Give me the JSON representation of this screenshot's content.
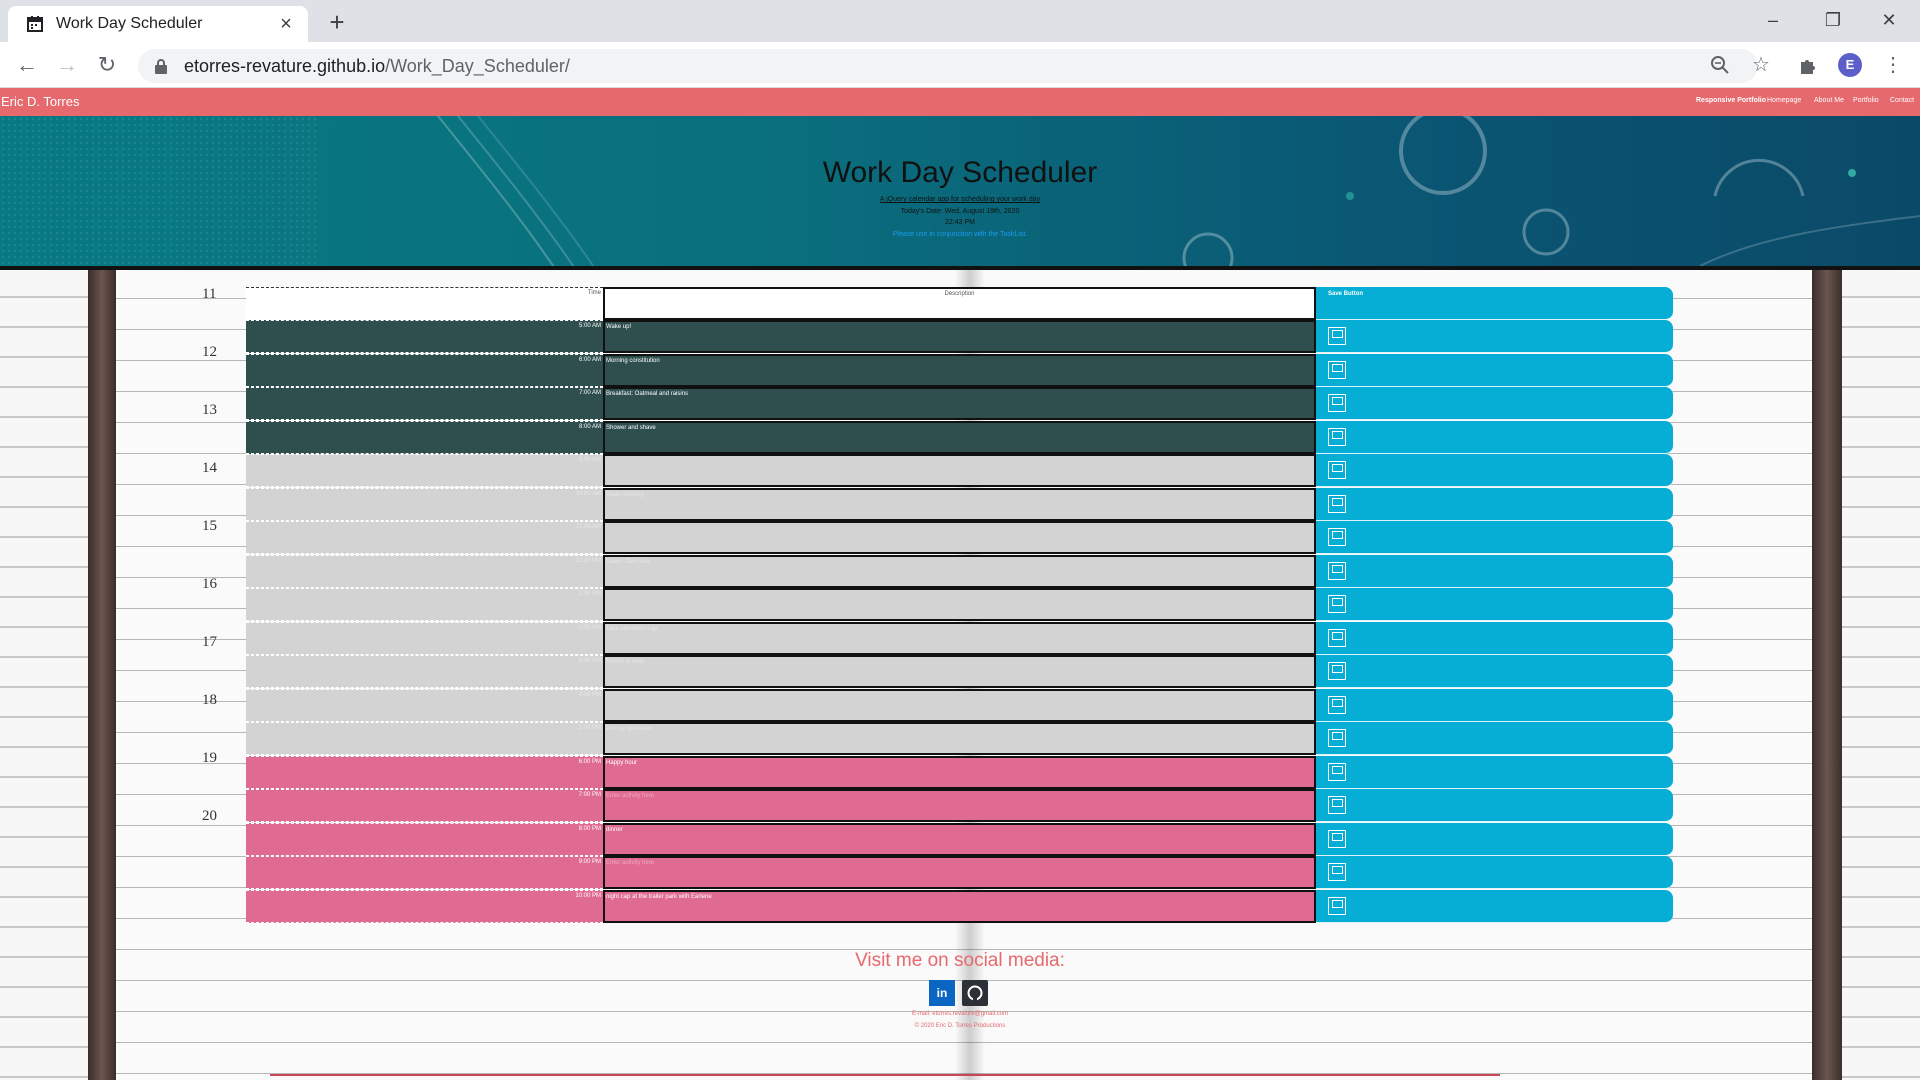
{
  "browser": {
    "tab_title": "Work Day Scheduler",
    "url_host": "etorres-revature.github.io",
    "url_path": "/Work_Day_Scheduler/",
    "profile_initial": "E"
  },
  "nav": {
    "brand": "Eric D. Torres",
    "links": [
      "Responsive Portfolio",
      "Homepage",
      "About Me",
      "Portfolio",
      "Contact"
    ]
  },
  "hero": {
    "title": "Work Day Scheduler",
    "subtitle": "A jQuery calendar app for scheduling your work day",
    "date_line": "Today's Date: Wed, August 19th, 2020",
    "time_line": "22:43 PM",
    "note": "Please use in conjunction with the TaskList."
  },
  "schedule": {
    "headers": {
      "time": "Time",
      "description": "Description",
      "save": "Save Button"
    },
    "rows": [
      {
        "time": "5:00 AM",
        "text": "Wake up!",
        "state": "past"
      },
      {
        "time": "6:00 AM",
        "text": "Morning constitution",
        "state": "past"
      },
      {
        "time": "7:00 AM",
        "text": "Breakfast: Oatmeal and raisins",
        "state": "past"
      },
      {
        "time": "8:00 AM",
        "text": "Shower and shave",
        "state": "past"
      },
      {
        "time": "9:00 AM",
        "text": "",
        "state": "present"
      },
      {
        "time": "10:00 AM",
        "text": "Team meeting",
        "state": "present"
      },
      {
        "time": "11:00 AM",
        "text": "",
        "state": "present"
      },
      {
        "time": "12:00 PM",
        "text": "Lunch: Dim sum",
        "state": "present"
      },
      {
        "time": "1:00 PM",
        "text": "",
        "state": "present"
      },
      {
        "time": "2:00 PM",
        "text": "Take afternoon nap",
        "state": "present"
      },
      {
        "time": "3:00 PM",
        "text": "Return to work",
        "state": "present"
      },
      {
        "time": "4:00 PM",
        "text": "",
        "state": "present"
      },
      {
        "time": "5:00 PM",
        "text": "Pick up groceries",
        "state": "present"
      },
      {
        "time": "6:00 PM",
        "text": "Happy hour",
        "state": "future"
      },
      {
        "time": "7:00 PM",
        "text": "Enter activity here",
        "state": "future",
        "placeholder": true
      },
      {
        "time": "8:00 PM",
        "text": "dinner",
        "state": "future"
      },
      {
        "time": "9:00 PM",
        "text": "Enter activity here",
        "state": "future",
        "placeholder": true
      },
      {
        "time": "10:00 PM",
        "text": "night cap at the trailer park with Earlene",
        "state": "future"
      }
    ]
  },
  "background": {
    "hour_numbers": [
      "11",
      "12",
      "13",
      "14",
      "15",
      "16",
      "17",
      "18",
      "19",
      "20"
    ]
  },
  "footer": {
    "social_title": "Visit me on social media:",
    "linkedin_icon": "in",
    "email_line": "E-mail: etorres.revature@gmail.com",
    "copyright": "© 2020 Eric D. Torres Productions"
  },
  "colors": {
    "nav": "#e6696e",
    "past": "#2f4f4f",
    "present": "#d3d3d3",
    "future": "#df6b92",
    "save": "#06aed5"
  }
}
